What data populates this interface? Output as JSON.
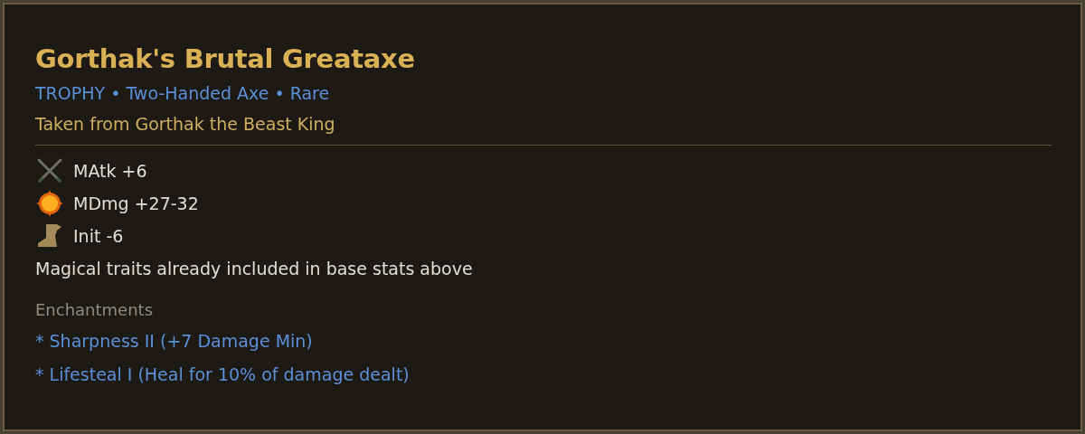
{
  "item": {
    "name": "Gorthak's Brutal Greataxe",
    "subtitle": "TROPHY • Two-Handed Axe • Rare",
    "source": "Taken from Gorthak the Beast King"
  },
  "stats": [
    {
      "kind": "attack",
      "text": "MAtk +6"
    },
    {
      "kind": "damage",
      "text": "MDmg +27-32"
    },
    {
      "kind": "initiative",
      "text": "Init -6"
    }
  ],
  "note": "Magical traits already included in base stats above",
  "enchantments": {
    "heading": "Enchantments",
    "items": [
      "* Sharpness II (+7 Damage Min)",
      "* Lifesteal I (Heal for 10% of damage dealt)"
    ]
  }
}
